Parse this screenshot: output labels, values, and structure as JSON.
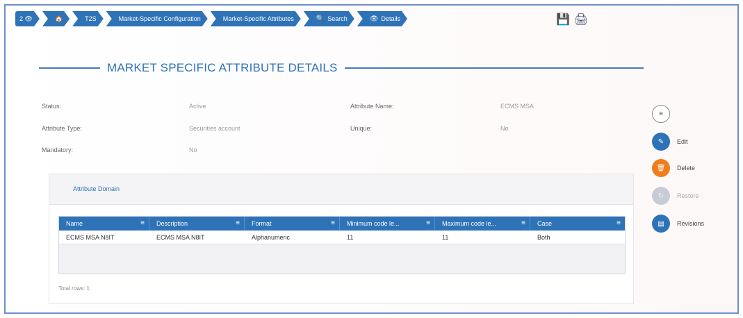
{
  "breadcrumb": {
    "items": [
      {
        "icon": "number-eye-icon",
        "label": "2 👁"
      },
      {
        "icon": "home-icon",
        "label": "🏠"
      },
      {
        "label": "T2S"
      },
      {
        "label": "Market-Specific Configuration"
      },
      {
        "label": "Market-Specific Attributes"
      },
      {
        "icon": "search-icon",
        "label": "Search"
      },
      {
        "icon": "eye-icon",
        "label": "Details"
      }
    ]
  },
  "toolbar": {
    "save_icon": "save-icon",
    "print_icon": "print-icon"
  },
  "page": {
    "title": "MARKET SPECIFIC ATTRIBUTE DETAILS"
  },
  "fields": {
    "status_label": "Status:",
    "status_value": "Active",
    "attribute_name_label": "Attribute Name:",
    "attribute_name_value": "ECMS MSA",
    "attribute_type_label": "Attribute Type:",
    "attribute_type_value": "Securities account",
    "unique_label": "Unique:",
    "unique_value": "No",
    "mandatory_label": "Mandatory:",
    "mandatory_value": "No"
  },
  "domain_panel": {
    "title": "Attribute Domain",
    "columns": [
      "Name",
      "Description",
      "Format",
      "Minimum code le...",
      "Maximum code le...",
      "Case"
    ],
    "rows": [
      [
        "ECMS MSA N8IT",
        "ECMS MSA N8IT",
        "Alphanumeric",
        "11",
        "11",
        "Both"
      ]
    ],
    "total_rows": "Total rows: 1"
  },
  "actions": {
    "menu_icon": "menu-icon",
    "edit_label": "Edit",
    "delete_label": "Delete",
    "restore_label": "Restore",
    "revisions_label": "Revisions"
  },
  "colors": {
    "primary": "#2e73b8",
    "delete": "#ee7d1c",
    "disabled": "#c8ccd4"
  }
}
